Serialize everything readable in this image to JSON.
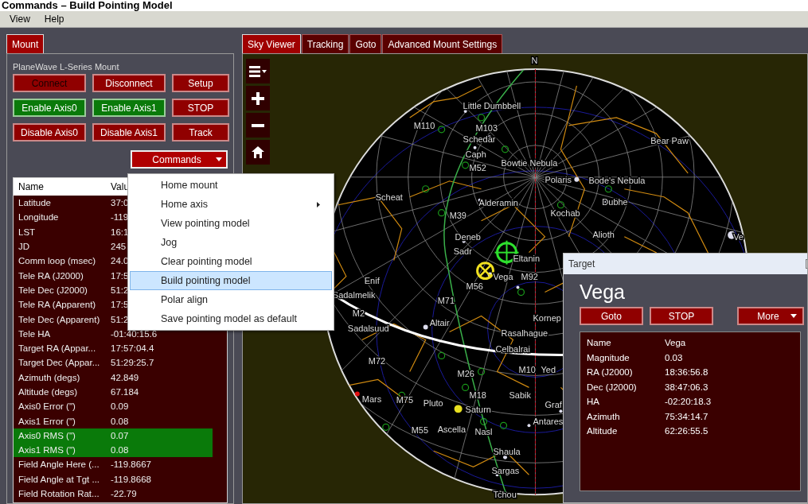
{
  "heading": "Commands – Build Pointing Model",
  "menu_bar": [
    "View",
    "Help"
  ],
  "left_panel": {
    "tabs": [
      {
        "label": "Mount",
        "selected": true
      }
    ],
    "group_title": "PlaneWave L-Series Mount",
    "buttons": [
      {
        "label": "Connect",
        "active": false,
        "disabled": true
      },
      {
        "label": "Disconnect",
        "active": false,
        "disabled": false
      },
      {
        "label": "Setup",
        "active": false,
        "disabled": false
      },
      {
        "label": "Enable Axis0",
        "active": true,
        "disabled": false
      },
      {
        "label": "Enable Axis1",
        "active": true,
        "disabled": false
      },
      {
        "label": "STOP",
        "active": false,
        "disabled": false
      },
      {
        "label": "Disable Axis0",
        "active": false,
        "disabled": false
      },
      {
        "label": "Disable Axis1",
        "active": false,
        "disabled": false
      },
      {
        "label": "Track",
        "active": false,
        "disabled": false
      }
    ],
    "commands_button": {
      "label": "Commands",
      "expanded": true
    },
    "table": {
      "columns": [
        "Name",
        "Valu"
      ],
      "rows": [
        {
          "name": "Latitude",
          "value": "37:0",
          "highlighted": false
        },
        {
          "name": "Longitude",
          "value": "-119",
          "highlighted": false
        },
        {
          "name": "LST",
          "value": "16:1",
          "highlighted": false
        },
        {
          "name": "JD",
          "value": "245",
          "highlighted": false
        },
        {
          "name": "Comm loop (msec)",
          "value": "24.0",
          "highlighted": false
        },
        {
          "name": "Tele RA (J2000)",
          "value": "17:5",
          "highlighted": false
        },
        {
          "name": "Tele Dec (J2000)",
          "value": "51:2",
          "highlighted": false
        },
        {
          "name": "Tele RA (Apparent)",
          "value": "17:5",
          "highlighted": false
        },
        {
          "name": "Tele Dec (Apparent)",
          "value": "51:2",
          "highlighted": false
        },
        {
          "name": "Tele HA",
          "value": "-01:40:15.6",
          "highlighted": false
        },
        {
          "name": "Target RA (Appar...",
          "value": "17:57:04.4",
          "highlighted": false
        },
        {
          "name": "Target Dec (Appar...",
          "value": "51:29:25.7",
          "highlighted": false
        },
        {
          "name": "Azimuth (degs)",
          "value": "42.849",
          "highlighted": false
        },
        {
          "name": "Altitude (degs)",
          "value": "67.184",
          "highlighted": false
        },
        {
          "name": "Axis0 Error (\")",
          "value": "0.09",
          "highlighted": false
        },
        {
          "name": "Axis1 Error (\")",
          "value": "0.08",
          "highlighted": false
        },
        {
          "name": "Axis0 RMS (\")",
          "value": "0.07",
          "highlighted": true
        },
        {
          "name": "Axis1 RMS (\")",
          "value": "0.08",
          "highlighted": true
        },
        {
          "name": "Field Angle Here (...",
          "value": "-119.8667",
          "highlighted": false
        },
        {
          "name": "Field Angle at Tgt ...",
          "value": "-119.8668",
          "highlighted": false
        },
        {
          "name": "Field Rotation Rat...",
          "value": "-22.79",
          "highlighted": false
        }
      ]
    }
  },
  "commands_menu": [
    {
      "label": "Home mount",
      "submenu": false,
      "selected": false
    },
    {
      "label": "Home axis",
      "submenu": true,
      "selected": false
    },
    {
      "label": "View pointing model",
      "submenu": false,
      "selected": false
    },
    {
      "label": "Jog",
      "submenu": false,
      "selected": false
    },
    {
      "label": "Clear pointing model",
      "submenu": false,
      "selected": false
    },
    {
      "label": "Build pointing model",
      "submenu": false,
      "selected": true
    },
    {
      "label": "Polar align",
      "submenu": false,
      "selected": false
    },
    {
      "label": "Save pointing model as default",
      "submenu": false,
      "selected": false
    }
  ],
  "sky_viewer": {
    "tabs": [
      {
        "label": "Sky Viewer",
        "selected": true
      },
      {
        "label": "Tracking",
        "selected": false
      },
      {
        "label": "Goto",
        "selected": false
      },
      {
        "label": "Advanced Mount Settings",
        "selected": false
      }
    ],
    "labels": [
      "N",
      "Little Dumbbell",
      "M110",
      "M103",
      "Schedar",
      "Caph",
      "M52",
      "Bowtie Nebula",
      "Polaris",
      "Bear Paw",
      "Bode's Nebula",
      "Dubhe",
      "Alioth",
      "Kochab",
      "Alderamin",
      "Scheat",
      "M39",
      "Deneb",
      "Sadr",
      "Eltanin",
      "Vega",
      "M92",
      "M56",
      "Enif",
      "Sadalmelik",
      "M2",
      "Sadalsuud",
      "M71",
      "Altair",
      "Kornep",
      "Rasalhague",
      "Celbalrai",
      "M10",
      "Yed",
      "M72",
      "M26",
      "M18",
      "Sabik",
      "Graf",
      "Antares",
      "Mars",
      "M75",
      "Pluto",
      "Saturn",
      "M55",
      "Ascella",
      "Nasl",
      "Shaula",
      "Sargas",
      "Tchou",
      "Ve"
    ]
  },
  "target_window": {
    "title": "Target",
    "object": "Vega",
    "buttons": [
      "Goto",
      "STOP"
    ],
    "more_button": "More",
    "rows": [
      {
        "name": "Name",
        "value": "Vega"
      },
      {
        "name": "Magnitude",
        "value": "0.03"
      },
      {
        "name": "RA (J2000)",
        "value": "18:36:56.8"
      },
      {
        "name": "Dec (J2000)",
        "value": "38:47:06.3"
      },
      {
        "name": "HA",
        "value": "-02:20:18.3"
      },
      {
        "name": "Azimuth",
        "value": "75:34:14.7"
      },
      {
        "name": "Altitude",
        "value": "62:26:55.5"
      }
    ]
  }
}
